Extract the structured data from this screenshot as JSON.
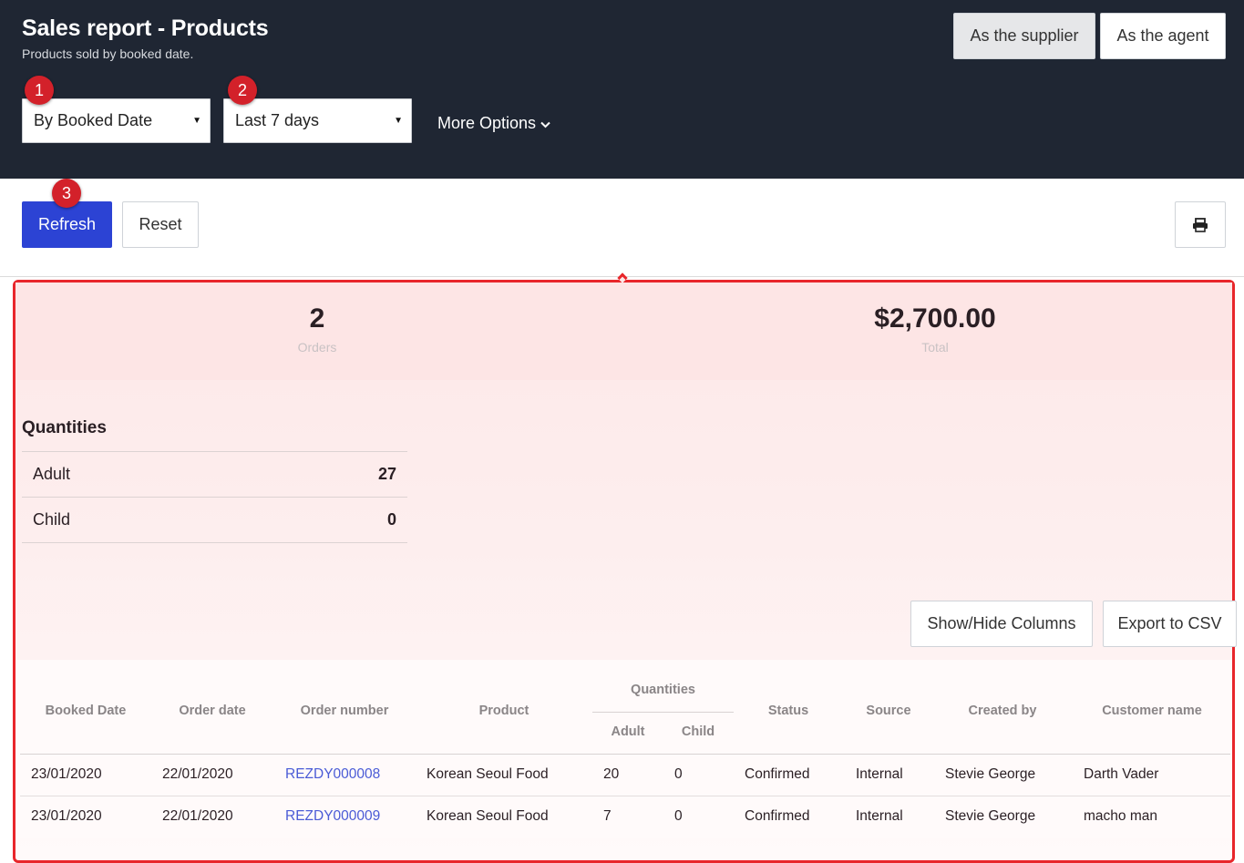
{
  "header": {
    "title": "Sales report - Products",
    "subtitle": "Products sold by booked date.",
    "mode_supplier": "As the supplier",
    "mode_agent": "As the agent",
    "date_basis_select": "By Booked Date",
    "date_range_select": "Last 7 days",
    "more_options": "More Options"
  },
  "badges": [
    "1",
    "2",
    "3"
  ],
  "actions": {
    "refresh": "Refresh",
    "reset": "Reset",
    "print_icon": "printer-icon"
  },
  "summary": {
    "orders_value": "2",
    "orders_label": "Orders",
    "total_value": "$2,700.00",
    "total_label": "Total"
  },
  "quantities": {
    "title": "Quantities",
    "rows": [
      {
        "label": "Adult",
        "value": "27"
      },
      {
        "label": "Child",
        "value": "0"
      }
    ]
  },
  "table_actions": {
    "show_hide": "Show/Hide Columns",
    "export": "Export to CSV"
  },
  "orders_table": {
    "headers": {
      "booked_date": "Booked Date",
      "order_date": "Order date",
      "order_number": "Order number",
      "product": "Product",
      "quantities": "Quantities",
      "adult": "Adult",
      "child": "Child",
      "status": "Status",
      "source": "Source",
      "created_by": "Created by",
      "customer_name": "Customer name"
    },
    "rows": [
      {
        "booked_date": "23/01/2020",
        "order_date": "22/01/2020",
        "order_number": "REZDY000008",
        "product": "Korean Seoul Food",
        "adult": "20",
        "child": "0",
        "status": "Confirmed",
        "source": "Internal",
        "created_by": "Stevie George",
        "customer_name": "Darth Vader"
      },
      {
        "booked_date": "23/01/2020",
        "order_date": "22/01/2020",
        "order_number": "REZDY000009",
        "product": "Korean Seoul Food",
        "adult": "7",
        "child": "0",
        "status": "Confirmed",
        "source": "Internal",
        "created_by": "Stevie George",
        "customer_name": "macho man"
      }
    ]
  },
  "colors": {
    "header_bg": "#1f2633",
    "primary": "#2c43d4",
    "highlight_border": "#e8262b",
    "badge": "#d3212a",
    "link": "#4a5bd6"
  }
}
